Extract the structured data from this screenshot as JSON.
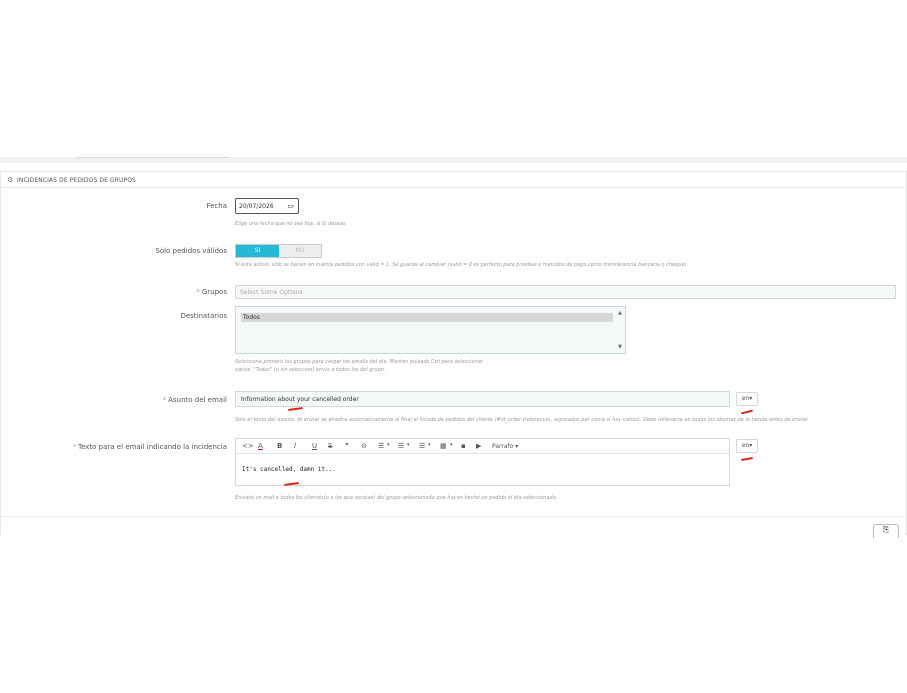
{
  "panel": {
    "title": "INCIDENCIAS DE PEDIDOS DE GRUPOS",
    "icon": "gears-icon"
  },
  "form": {
    "fecha": {
      "label": "Fecha",
      "value": "20/07/2026",
      "help": "Elige una fecha que no sea hoy, si lo deseas"
    },
    "solo_validos": {
      "label": "Solo pedidos válidos",
      "on_label": "SI",
      "off_label": "NO",
      "active": "SI",
      "help": "Si esta activo, solo se tienen en cuenta pedidos con valid = 1. Se guarda al cambiar (valid = 0 es perfecto para pruebas o metodos de pago como transferencia bancaria o cheque)."
    },
    "grupos": {
      "required": "*",
      "label": "Grupos",
      "placeholder": "Select Some Options"
    },
    "destinatarios": {
      "label": "Destinatarios",
      "options": [
        "Todos"
      ],
      "help_line1": "Selecciona primero los grupos para cargar los emails del dia. Manten pulsado Ctrl para seleccionar",
      "help_line2": "varios. \"Todos\" (o sin seleccion) envia a todos los del grupo."
    },
    "asunto": {
      "required": "*",
      "label": "Asunto del email",
      "value": "Information about your cancelled order",
      "lang": "en",
      "help": "Solo el texto del asunto. Al enviar se añadira automaticamente al final el listado de pedidos del cliente (#id_order (reference), separados por coma si hay varios). Debe rellenarse en todos los idiomas de la tienda antes de enviar."
    },
    "texto": {
      "required": "*",
      "label": "Texto para el email indicando la incidencia",
      "body": "It's cancelled, damn it...",
      "lang": "en",
      "help": "Enviará un mail a todos los clientes(o a los que escojas) del grupo seleccionado que hayan hecho un pedido el dia seleccionado.",
      "toolbar": {
        "code": "<>",
        "text_color": "A",
        "bold": "B",
        "italic": "I",
        "underline": "U",
        "strike": "S",
        "quote": "❞",
        "link": "⊝",
        "align": "☰",
        "bullets": "☰",
        "numbers": "☰",
        "table": "▦",
        "image": "▪",
        "media": "▶",
        "block_format": "Parrafo"
      }
    }
  },
  "footer": {
    "save_icon": "save-icon"
  }
}
